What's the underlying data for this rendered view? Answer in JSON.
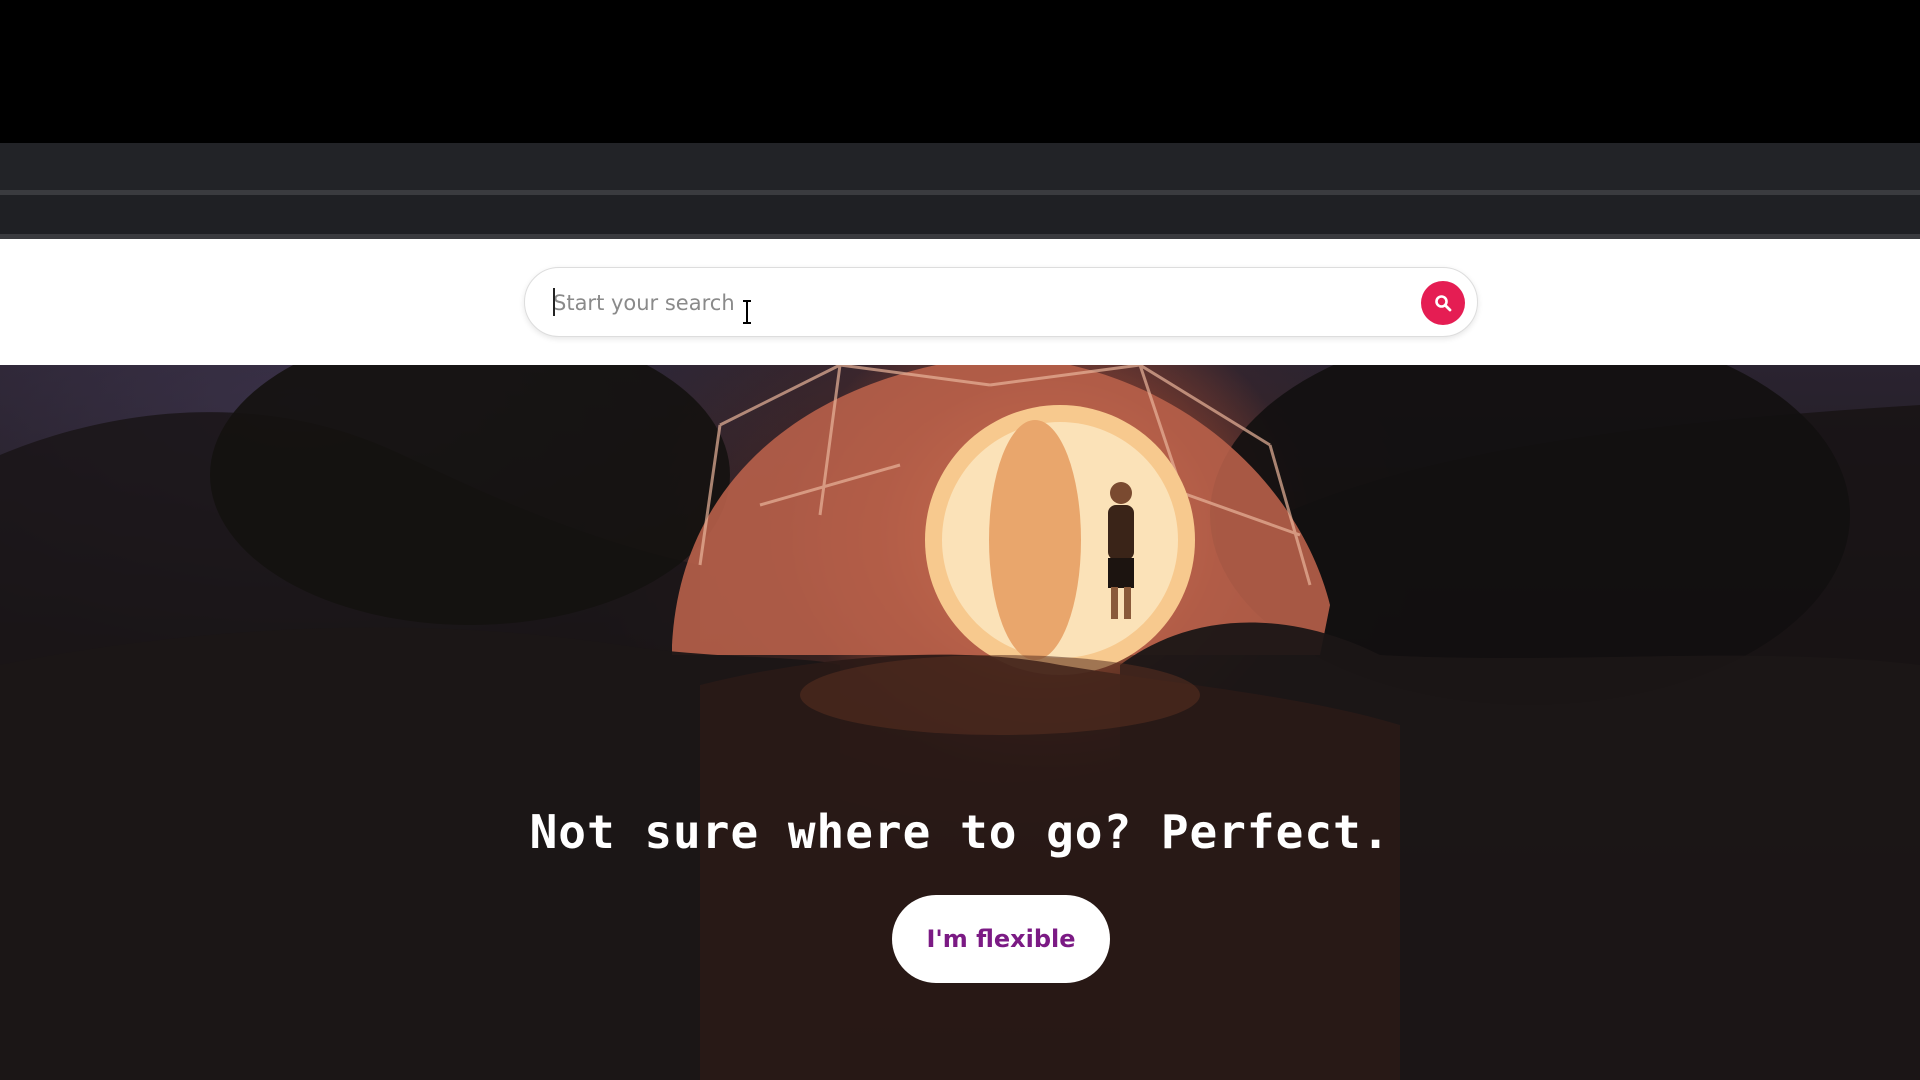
{
  "search": {
    "placeholder": "Start your search",
    "button_icon": "search-icon",
    "button_color": "#e51d53"
  },
  "hero": {
    "title": "Not sure where to go? Perfect.",
    "button_label": "I'm flexible",
    "button_text_color": "#7b1a84"
  }
}
